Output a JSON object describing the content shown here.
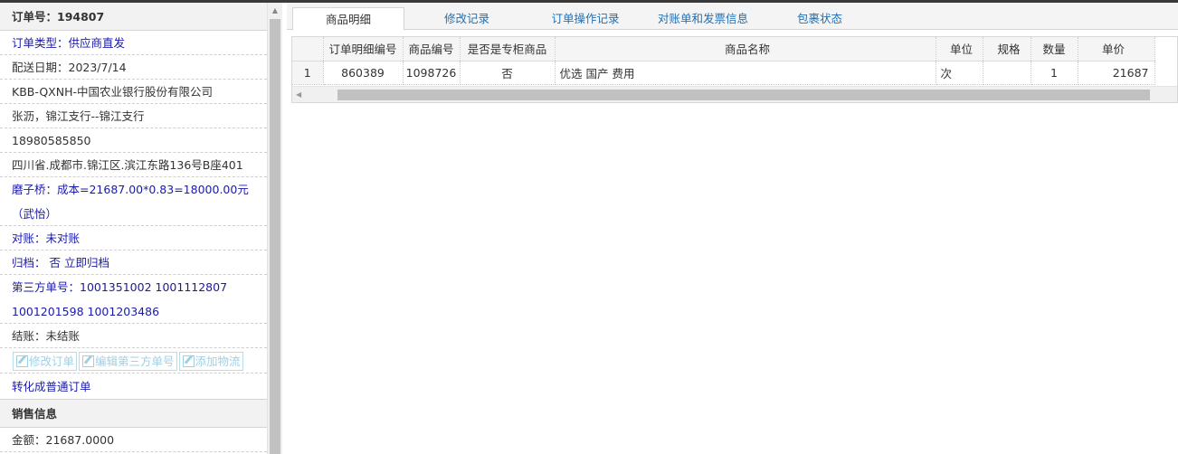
{
  "left": {
    "order_no": "订单号：194807",
    "order_type": "订单类型：供应商直发",
    "delivery_date": "配送日期：2023/7/14",
    "customer": "KBB-QXNH-中国农业银行股份有限公司",
    "contact": "张沥，锦江支行--锦江支行",
    "phone": "18980585850",
    "address": "四川省.成都市.锦江区.滨江东路136号B座401",
    "cost_note": "磨子桥：成本=21687.00*0.83=18000.00元（武怡）",
    "reconcile": "对账：未对账",
    "archive": "归档： 否 立即归档",
    "third_party_label": "第三方单号：1001351002 1001112807",
    "third_party_more": "1001201598 1001203486",
    "settlement": "结账：未结账",
    "buttons": {
      "edit_order": "修改订单",
      "edit_third": "编辑第三方单号",
      "add_logistics": "添加物流"
    },
    "convert_link": "转化成普通订单",
    "sales_header": "销售信息",
    "amount": "金额：21687.0000"
  },
  "tabs": [
    "商品明细",
    "修改记录",
    "订单操作记录",
    "对账单和发票信息",
    "包裹状态"
  ],
  "grid": {
    "headers": [
      "订单明细编号",
      "商品编号",
      "是否是专柜商品",
      "商品名称",
      "单位",
      "规格",
      "数量",
      "单价"
    ],
    "rows": [
      {
        "rownum": "1",
        "detail_no": "860389",
        "product_no": "1098726",
        "counter": "否",
        "name": "优选 国产 费用",
        "unit": "次",
        "spec": "",
        "qty": "1",
        "price": "21687"
      }
    ]
  }
}
